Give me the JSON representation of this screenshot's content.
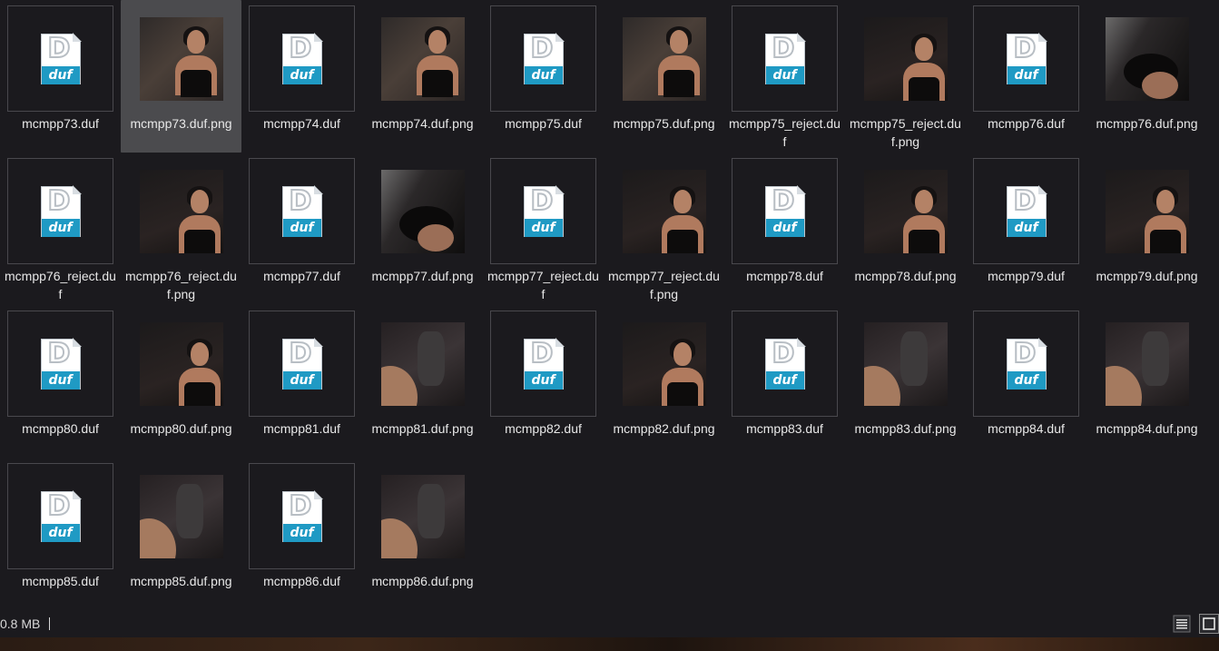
{
  "files": [
    {
      "name": "mcmpp73.duf",
      "kind": "duf",
      "icon": "duf-file-icon"
    },
    {
      "name": "mcmpp73.duf.png",
      "kind": "png",
      "icon": "image-thumbnail",
      "selected": true
    },
    {
      "name": "mcmpp74.duf",
      "kind": "duf",
      "icon": "duf-file-icon"
    },
    {
      "name": "mcmpp74.duf.png",
      "kind": "png",
      "icon": "image-thumbnail"
    },
    {
      "name": "mcmpp75.duf",
      "kind": "duf",
      "icon": "duf-file-icon"
    },
    {
      "name": "mcmpp75.duf.png",
      "kind": "png",
      "icon": "image-thumbnail"
    },
    {
      "name": "mcmpp75_reject.duf",
      "kind": "duf",
      "icon": "duf-file-icon"
    },
    {
      "name": "mcmpp75_reject.duf.png",
      "kind": "png",
      "icon": "image-thumbnail"
    },
    {
      "name": "mcmpp76.duf",
      "kind": "duf",
      "icon": "duf-file-icon"
    },
    {
      "name": "mcmpp76.duf.png",
      "kind": "png",
      "icon": "image-thumbnail"
    },
    {
      "name": "mcmpp76_reject.duf",
      "kind": "duf",
      "icon": "duf-file-icon"
    },
    {
      "name": "mcmpp76_reject.duf.png",
      "kind": "png",
      "icon": "image-thumbnail"
    },
    {
      "name": "mcmpp77.duf",
      "kind": "duf",
      "icon": "duf-file-icon"
    },
    {
      "name": "mcmpp77.duf.png",
      "kind": "png",
      "icon": "image-thumbnail"
    },
    {
      "name": "mcmpp77_reject.duf",
      "kind": "duf",
      "icon": "duf-file-icon"
    },
    {
      "name": "mcmpp77_reject.duf.png",
      "kind": "png",
      "icon": "image-thumbnail"
    },
    {
      "name": "mcmpp78.duf",
      "kind": "duf",
      "icon": "duf-file-icon"
    },
    {
      "name": "mcmpp78.duf.png",
      "kind": "png",
      "icon": "image-thumbnail"
    },
    {
      "name": "mcmpp79.duf",
      "kind": "duf",
      "icon": "duf-file-icon"
    },
    {
      "name": "mcmpp79.duf.png",
      "kind": "png",
      "icon": "image-thumbnail"
    },
    {
      "name": "mcmpp80.duf",
      "kind": "duf",
      "icon": "duf-file-icon"
    },
    {
      "name": "mcmpp80.duf.png",
      "kind": "png",
      "icon": "image-thumbnail"
    },
    {
      "name": "mcmpp81.duf",
      "kind": "duf",
      "icon": "duf-file-icon"
    },
    {
      "name": "mcmpp81.duf.png",
      "kind": "png",
      "icon": "image-thumbnail"
    },
    {
      "name": "mcmpp82.duf",
      "kind": "duf",
      "icon": "duf-file-icon"
    },
    {
      "name": "mcmpp82.duf.png",
      "kind": "png",
      "icon": "image-thumbnail"
    },
    {
      "name": "mcmpp83.duf",
      "kind": "duf",
      "icon": "duf-file-icon"
    },
    {
      "name": "mcmpp83.duf.png",
      "kind": "png",
      "icon": "image-thumbnail"
    },
    {
      "name": "mcmpp84.duf",
      "kind": "duf",
      "icon": "duf-file-icon"
    },
    {
      "name": "mcmpp84.duf.png",
      "kind": "png",
      "icon": "image-thumbnail"
    },
    {
      "name": "mcmpp85.duf",
      "kind": "duf",
      "icon": "duf-file-icon"
    },
    {
      "name": "mcmpp85.duf.png",
      "kind": "png",
      "icon": "image-thumbnail"
    },
    {
      "name": "mcmpp86.duf",
      "kind": "duf",
      "icon": "duf-file-icon"
    },
    {
      "name": "mcmpp86.duf.png",
      "kind": "png",
      "icon": "image-thumbnail"
    }
  ],
  "duf_icon_text": "duf",
  "status_bar": {
    "size_text": "0.8 MB",
    "details_view_icon": "details-view-icon",
    "large_icons_view_icon": "large-icons-view-icon"
  },
  "colors": {
    "background": "#1b1a1e",
    "selection": "#4b4b4e",
    "duf_accent": "#1f9ac4"
  }
}
